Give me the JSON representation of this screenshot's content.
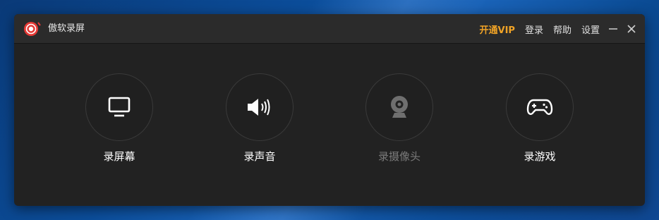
{
  "app": {
    "title": "傲软录屏"
  },
  "menu": {
    "vip": "开通VIP",
    "login": "登录",
    "help": "帮助",
    "settings": "设置"
  },
  "features": [
    {
      "id": "screen",
      "label": "录屏幕",
      "icon": "monitor-icon",
      "enabled": true
    },
    {
      "id": "audio",
      "label": "录声音",
      "icon": "speaker-icon",
      "enabled": true
    },
    {
      "id": "camera",
      "label": "录摄像头",
      "icon": "webcam-icon",
      "enabled": false
    },
    {
      "id": "game",
      "label": "录游戏",
      "icon": "gamepad-icon",
      "enabled": true
    }
  ],
  "colors": {
    "accent_vip": "#f0a326",
    "window_bg": "#222222",
    "titlebar_bg": "#2b2b2b",
    "logo_red": "#e53935",
    "disabled_text": "#7a7a7a"
  }
}
